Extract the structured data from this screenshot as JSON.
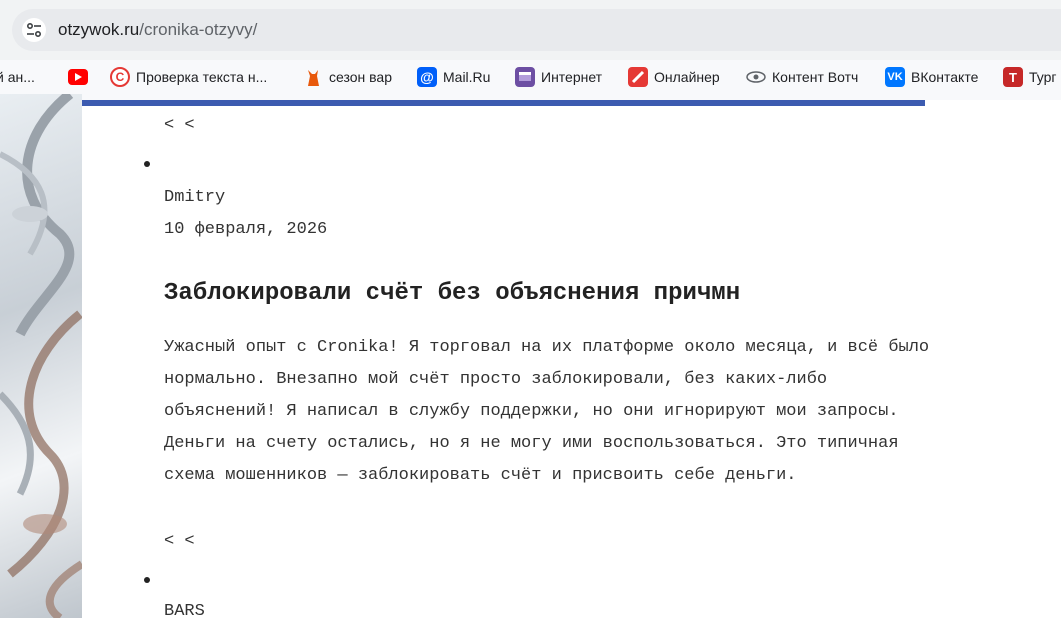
{
  "browser": {
    "url_domain": "otzywok.ru",
    "url_path": "/cronika-otzyvy/"
  },
  "bookmarks": [
    {
      "label": "й ан...",
      "icon": "truncated-bookmark"
    },
    {
      "label": "",
      "icon": "youtube-icon"
    },
    {
      "label": "Проверка текста н...",
      "icon": "copyright-icon"
    },
    {
      "label": "сезон вар",
      "icon": "cat-icon"
    },
    {
      "label": "Mail.Ru",
      "icon": "mail-at-icon"
    },
    {
      "label": "Интернет",
      "icon": "purple-box-icon"
    },
    {
      "label": "Онлайнер",
      "icon": "onliner-icon"
    },
    {
      "label": "Контент Вотч",
      "icon": "eye-icon"
    },
    {
      "label": "ВКонтакте",
      "icon": "vk-icon"
    },
    {
      "label": "Тург",
      "icon": "t-icon"
    }
  ],
  "colors": {
    "progress": "#3c5bb0",
    "youtube": "#ff0000",
    "vk": "#0077ff",
    "mailru": "#005ff9"
  },
  "review1": {
    "nav": "< <",
    "author": "Dmitry",
    "date": "10 февраля, 2026",
    "title": "Заблокировали счёт без объяснения причмн",
    "body": [
      "Ужасный опыт с Cronika! Я торговал на их платформе около месяца, и всё было",
      "нормально. Внезапно мой счёт просто заблокировали, без каких-либо",
      "объяснений! Я написал в службу поддержки, но они игнорируют мои запросы.",
      "Деньги на счету остались, но я не могу ими воспользоваться. Это типичная",
      "схема мошенников — заблокировать счёт и присвоить себе деньги."
    ]
  },
  "review2": {
    "nav": "< <",
    "author": "BARS"
  }
}
